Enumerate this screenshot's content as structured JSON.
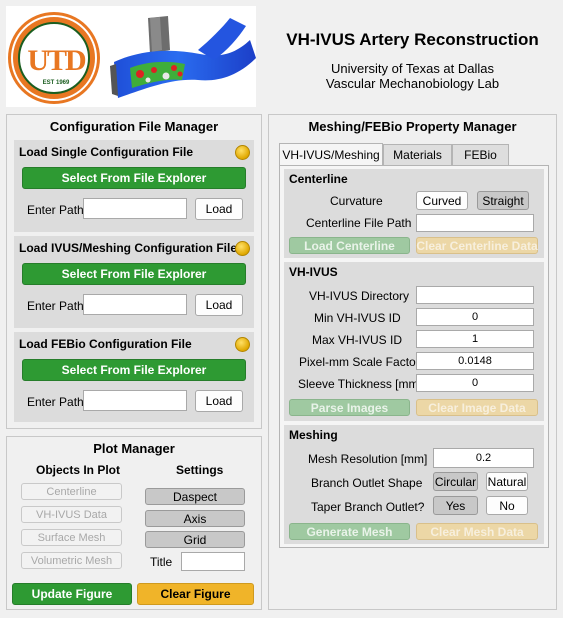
{
  "header": {
    "title": "VH-IVUS Artery Reconstruction",
    "subtitle1": "University of Texas at Dallas",
    "subtitle2": "Vascular Mechanobiology Lab",
    "logo_text": "UTD",
    "logo_ring_text": "THE UNIVERSITY OF TEXAS AT DALLAS",
    "logo_est": "EST 1969"
  },
  "config_manager": {
    "title": "Configuration File Manager",
    "sections": [
      {
        "title": "Load Single Configuration File",
        "select_label": "Select From File Explorer",
        "path_label": "Enter Path",
        "path_value": "",
        "load_label": "Load"
      },
      {
        "title": "Load IVUS/Meshing Configuration File",
        "select_label": "Select From File Explorer",
        "path_label": "Enter Path",
        "path_value": "",
        "load_label": "Load"
      },
      {
        "title": "Load FEBio Configuration File",
        "select_label": "Select From File Explorer",
        "path_label": "Enter Path",
        "path_value": "",
        "load_label": "Load"
      }
    ]
  },
  "plot_manager": {
    "title": "Plot Manager",
    "objects_header": "Objects In Plot",
    "settings_header": "Settings",
    "objects": [
      "Centerline",
      "VH-IVUS Data",
      "Surface Mesh",
      "Volumetric Mesh"
    ],
    "settings": [
      "Daspect",
      "Axis",
      "Grid"
    ],
    "title_label": "Title",
    "title_value": "",
    "update_label": "Update Figure",
    "clear_label": "Clear Figure"
  },
  "property_manager": {
    "title": "Meshing/FEBio Property Manager",
    "tabs": [
      "VH-IVUS/Meshing",
      "Materials",
      "FEBio"
    ],
    "active_tab": "VH-IVUS/Meshing",
    "centerline": {
      "title": "Centerline",
      "curvature_label": "Curvature",
      "curved_label": "Curved",
      "straight_label": "Straight",
      "file_path_label": "Centerline File Path",
      "file_path_value": "",
      "load_label": "Load Centerline",
      "clear_label": "Clear Centerline Data"
    },
    "vhivus": {
      "title": "VH-IVUS",
      "directory_label": "VH-IVUS Directory",
      "directory_value": "",
      "min_id_label": "Min VH-IVUS ID",
      "min_id_value": "0",
      "max_id_label": "Max VH-IVUS ID",
      "max_id_value": "1",
      "scale_label": "Pixel-mm Scale Factor",
      "scale_value": "0.0148",
      "sleeve_label": "Sleeve Thickness [mm]",
      "sleeve_value": "0",
      "parse_label": "Parse Images",
      "clear_label": "Clear Image Data"
    },
    "meshing": {
      "title": "Meshing",
      "resolution_label": "Mesh Resolution [mm]",
      "resolution_value": "0.2",
      "branch_label": "Branch Outlet Shape",
      "circular_label": "Circular",
      "natural_label": "Natural",
      "taper_label": "Taper Branch Outlet?",
      "yes_label": "Yes",
      "no_label": "No",
      "generate_label": "Generate Mesh",
      "clear_label": "Clear Mesh Data"
    }
  },
  "colors": {
    "primary_green": "#2e9a33",
    "amber": "#f0b429",
    "status_lamp": "#f2c200",
    "utd_orange": "#e87722",
    "utd_green": "#1b5e20"
  }
}
